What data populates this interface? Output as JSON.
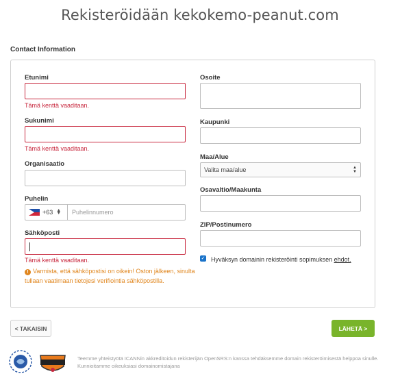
{
  "page": {
    "title": "Rekisteröidään kekokemo-peanut.com",
    "section_label": "Contact Information"
  },
  "form": {
    "first_name": {
      "label": "Etunimi",
      "value": "",
      "error": "Tämä kenttä vaaditaan."
    },
    "last_name": {
      "label": "Sukunimi",
      "value": "",
      "error": "Tämä kenttä vaaditaan."
    },
    "organization": {
      "label": "Organisaatio",
      "value": ""
    },
    "phone": {
      "label": "Puhelin",
      "country_code": "+63",
      "country_flag": "philippines-flag-icon",
      "placeholder": "Puhelinnumero",
      "value": ""
    },
    "email": {
      "label": "Sähköposti",
      "value": "",
      "error": "Tämä kenttä vaaditaan.",
      "warning": "Varmista, että sähköpostisi on oikein! Oston jälkeen, sinulta tullaan vaatimaan tietojesi verifiointia sähköpostilla."
    },
    "address": {
      "label": "Osoite",
      "value": ""
    },
    "city": {
      "label": "Kaupunki",
      "value": ""
    },
    "country": {
      "label": "Maa/Alue",
      "selected": "Valita maa/alue"
    },
    "state": {
      "label": "Osavaltio/Maakunta",
      "value": ""
    },
    "zip": {
      "label": "ZIP/Postinumero",
      "value": ""
    },
    "agreement": {
      "checked": true,
      "text": "Hyväksyn domainin rekisteröinti sopimuksen",
      "link_text": "ehdot."
    }
  },
  "buttons": {
    "back": "< TAKAISIN",
    "next": "LÄHETÄ >"
  },
  "footer": {
    "logo_icann": "ICANN",
    "logo_icann_sub": "accredited registrar",
    "logo_opensrs": "OPENSRS",
    "text": "Teemme yhteistyötä ICANNin akkreditoidun rekisterijän OpenSRS:n kanssa tehdäksemme domain rekisteröimisestä helppoa sinulle. Kunnioitamme oikeuksiasi domainomistajana"
  },
  "colors": {
    "error": "#c8283e",
    "warning": "#e0861e",
    "primary_button": "#79b42b",
    "checkbox": "#1a73c9"
  }
}
